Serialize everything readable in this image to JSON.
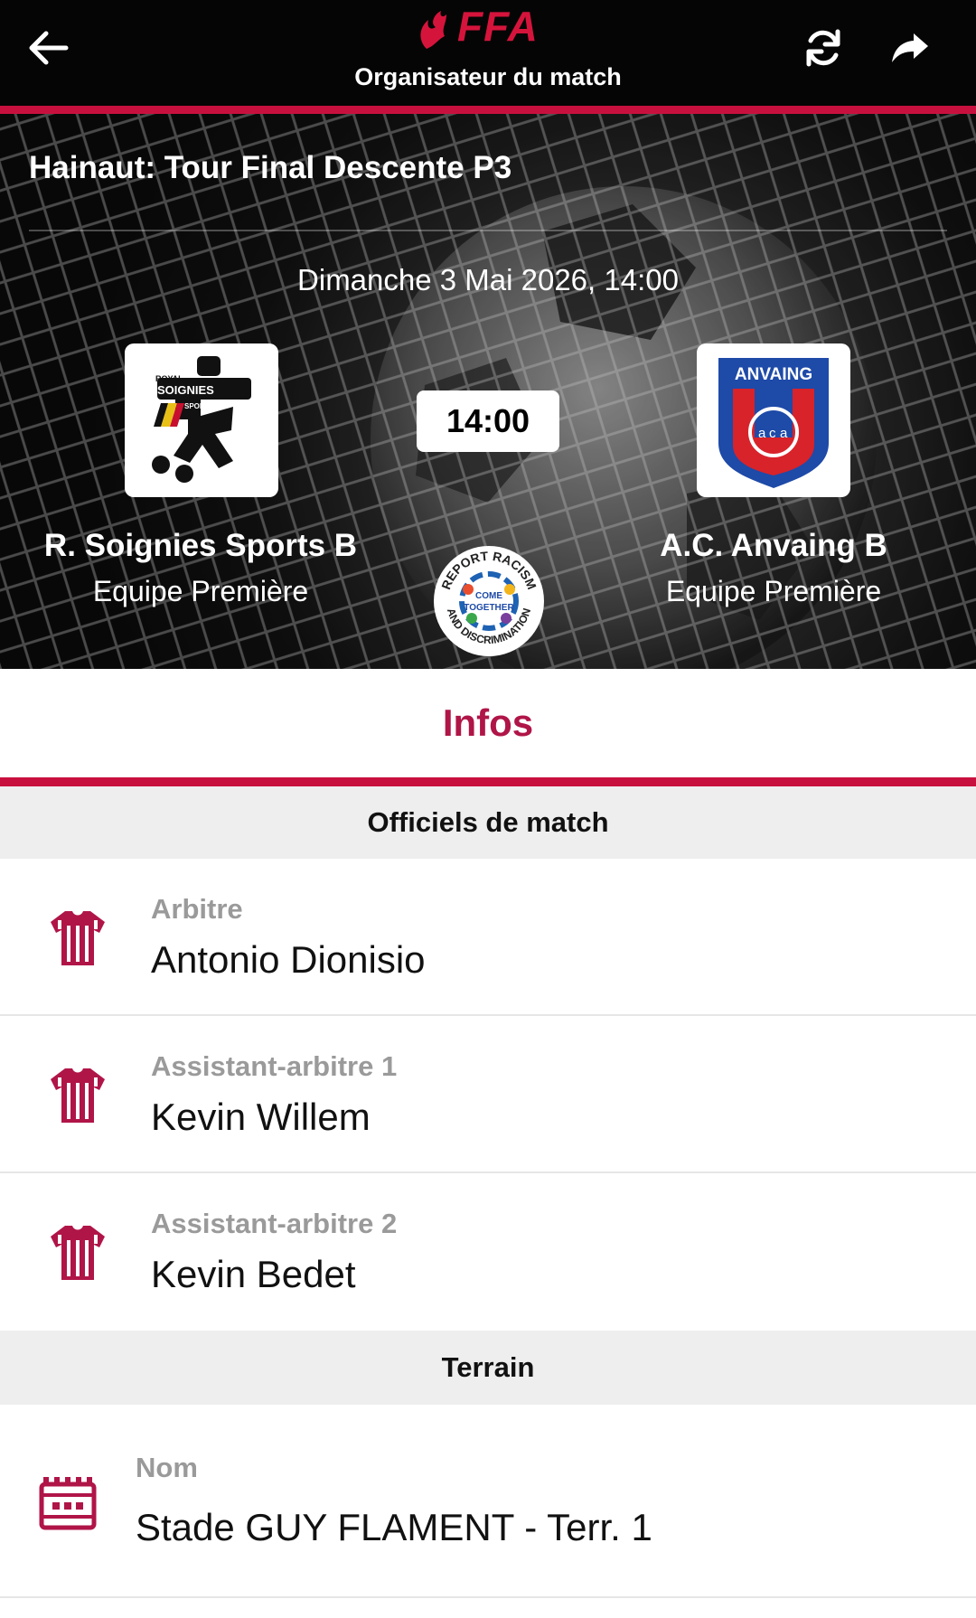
{
  "header": {
    "brand": "FFA",
    "title": "Organisateur du match",
    "back_icon": "arrow-left-icon",
    "refresh_icon": "refresh-icon",
    "share_icon": "share-icon"
  },
  "match": {
    "competition": "Hainaut: Tour Final Descente P3",
    "date": "Dimanche 3 Mai 2026, 14:00",
    "time": "14:00",
    "home": {
      "name": "R. Soignies Sports B",
      "category": "Equipe Première",
      "crest_text": [
        "ROYAL",
        "SOIGNIES",
        "SPORTS"
      ]
    },
    "away": {
      "name": "A.C. Anvaing B",
      "category": "Equipe Première",
      "crest_text": [
        "ANVAING",
        "a",
        "c",
        "a"
      ]
    },
    "badge_text": [
      "REPORT RACISM",
      "AND DISCRIMINATION",
      "COME",
      "TOGETHER"
    ]
  },
  "tabs": {
    "active": "Infos"
  },
  "officials": {
    "header": "Officiels de match",
    "items": [
      {
        "role": "Arbitre",
        "name": "Antonio Dionisio"
      },
      {
        "role": "Assistant-arbitre 1",
        "name": "Kevin Willem"
      },
      {
        "role": "Assistant-arbitre 2",
        "name": "Kevin Bedet"
      }
    ]
  },
  "terrain": {
    "header": "Terrain",
    "label": "Nom",
    "value": "Stade GUY FLAMENT - Terr. 1"
  },
  "colors": {
    "accent": "#c8103e",
    "accent_text": "#b01548",
    "topbar": "#050505"
  }
}
